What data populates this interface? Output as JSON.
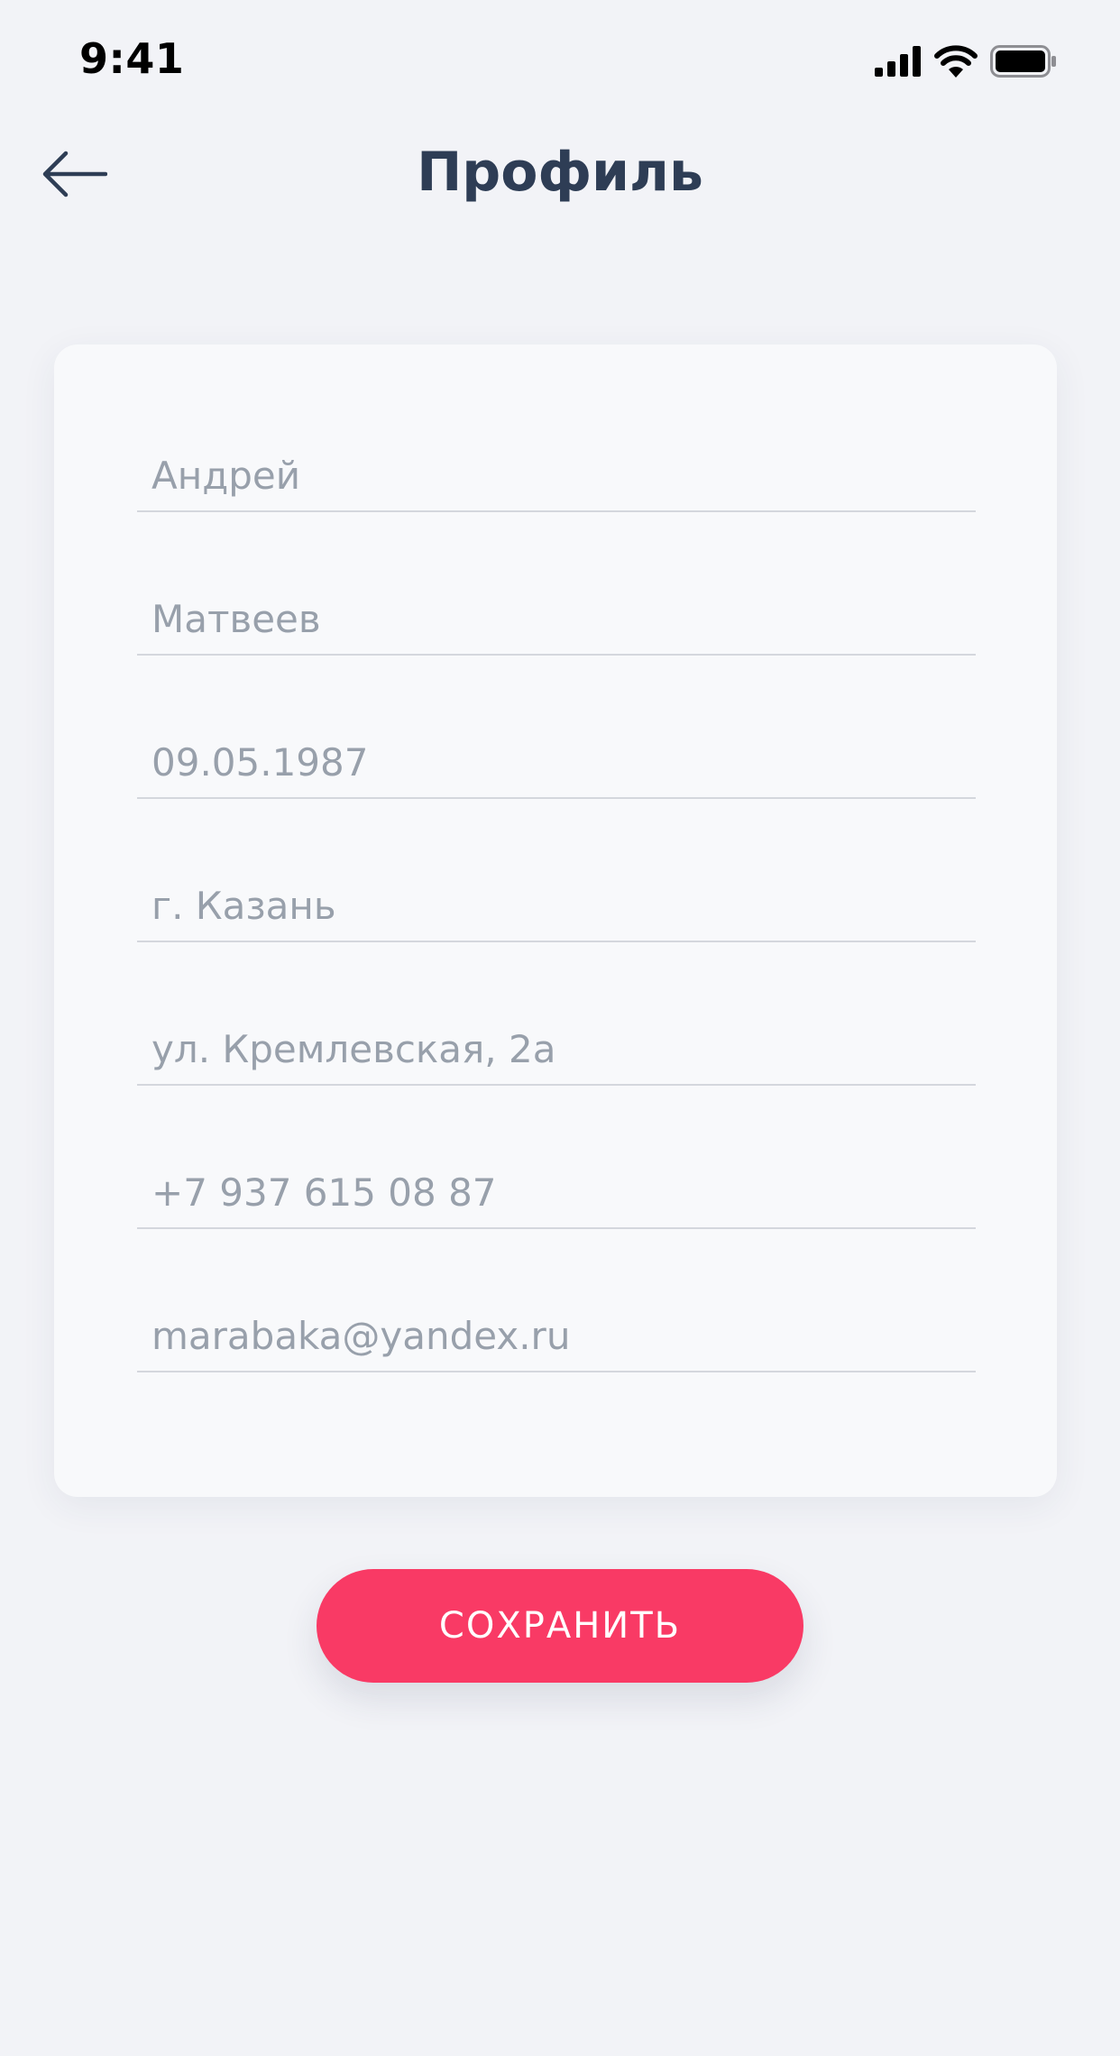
{
  "status_bar": {
    "time": "9:41",
    "icons": [
      "cellular-signal-icon",
      "wifi-icon",
      "battery-icon"
    ]
  },
  "header": {
    "title": "Профиль",
    "back_icon": "arrow-left-icon"
  },
  "form": {
    "fields": [
      {
        "name": "first-name",
        "placeholder": "Андрей"
      },
      {
        "name": "last-name",
        "placeholder": "Матвеев"
      },
      {
        "name": "birth-date",
        "placeholder": "09.05.1987"
      },
      {
        "name": "city",
        "placeholder": "г. Казань"
      },
      {
        "name": "address",
        "placeholder": "ул. Кремлевская, 2а"
      },
      {
        "name": "phone",
        "placeholder": "+7 937 615 08 87"
      },
      {
        "name": "email",
        "placeholder": "marabaka@yandex.ru"
      }
    ]
  },
  "actions": {
    "save_label": "СОХРАНИТЬ"
  },
  "colors": {
    "background": "#f2f3f7",
    "card": "#f8f9fb",
    "title": "#2e3d55",
    "placeholder": "#98a0ab",
    "divider": "#d4d7dd",
    "accent": "#f93a65"
  }
}
